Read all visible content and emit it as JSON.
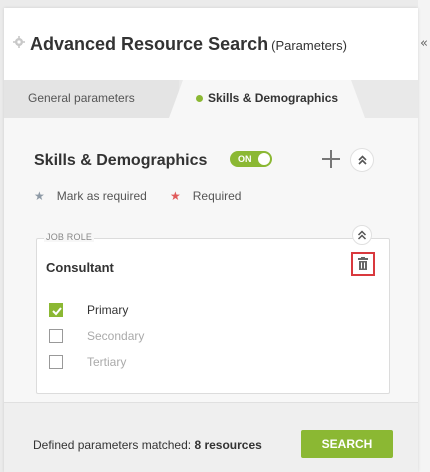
{
  "header": {
    "title": "Advanced Resource Search",
    "subtitle": "(Parameters)",
    "collapse_glyph": "«"
  },
  "tabs": [
    {
      "label": "General parameters",
      "active": false
    },
    {
      "label": "Skills & Demographics",
      "active": true
    }
  ],
  "section": {
    "title": "Skills & Demographics",
    "toggle_label": "ON",
    "toggle_on": true
  },
  "legend": {
    "mark_as_required": "Mark as required",
    "required": "Required"
  },
  "job_role": {
    "label": "JOB ROLE",
    "value": "Consultant",
    "options": [
      {
        "label": "Primary",
        "checked": true
      },
      {
        "label": "Secondary",
        "checked": false
      },
      {
        "label": "Tertiary",
        "checked": false
      }
    ]
  },
  "footer": {
    "matched_prefix": "Defined parameters matched:",
    "matched_count": "8 resources",
    "search_label": "SEARCH"
  },
  "colors": {
    "accent": "#8bb833",
    "required_star": "#e05a5a",
    "mark_star": "#8e9aa6",
    "highlight_border": "#d9393e"
  },
  "icons": [
    "gear-icon",
    "plus-icon",
    "chevron-up-double-icon",
    "trash-icon",
    "star-icon",
    "checkmark-icon"
  ]
}
